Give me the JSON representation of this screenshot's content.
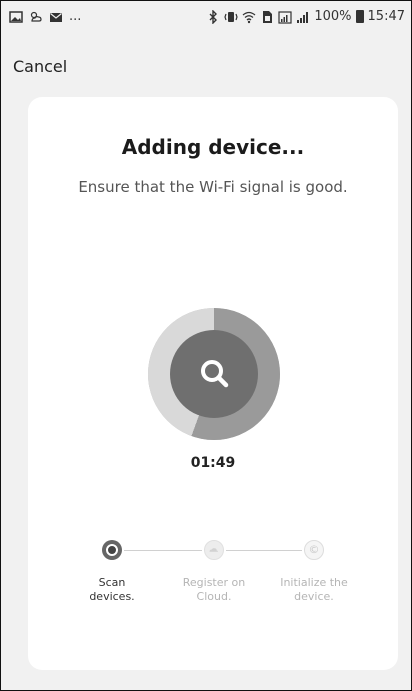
{
  "status_bar": {
    "left_icons": [
      "image-icon",
      "cloud-weather-icon",
      "mail-icon"
    ],
    "left_more": "...",
    "right_icons": [
      "bluetooth-icon",
      "vibrate-icon",
      "wifi-icon",
      "sim-icon",
      "signal-icon"
    ],
    "battery": "100%",
    "time": "15:47"
  },
  "header": {
    "cancel_label": "Cancel"
  },
  "card": {
    "title": "Adding device...",
    "subtitle": "Ensure that the Wi-Fi signal is good.",
    "timer": "01:49"
  },
  "steps": [
    {
      "line1": "Scan",
      "line2": "devices.",
      "state": "active",
      "icon": "radio-dot-icon"
    },
    {
      "line1": "Register on",
      "line2": "Cloud.",
      "state": "pending",
      "icon": "cloud-icon"
    },
    {
      "line1": "Initialize the",
      "line2": "device.",
      "state": "pending",
      "icon": "copyright-circle-icon"
    }
  ],
  "colors": {
    "background": "#f1f1f1",
    "card": "#ffffff",
    "active": "#666666",
    "inactive": "#b5b5b5"
  }
}
